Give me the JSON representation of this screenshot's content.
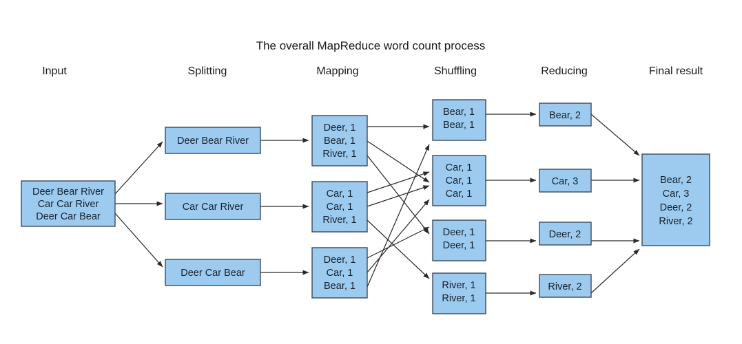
{
  "title": "The overall MapReduce word count process",
  "colors": {
    "box_fill": "#9dcbf0",
    "box_stroke": "#3a4a5a",
    "edge": "#2b2b2b",
    "text": "#16202b",
    "background": "#ffffff"
  },
  "headers": [
    {
      "label": "Input"
    },
    {
      "label": "Splitting"
    },
    {
      "label": "Mapping"
    },
    {
      "label": "Shuffling"
    },
    {
      "label": "Reducing"
    },
    {
      "label": "Final result"
    }
  ],
  "stages": {
    "input": {
      "label": "Input",
      "boxes": [
        {
          "lines": [
            "Deer Bear River",
            "Car Car River",
            "Deer Car Bear"
          ]
        }
      ]
    },
    "splitting": {
      "label": "Splitting",
      "boxes": [
        {
          "lines": [
            "Deer Bear River"
          ]
        },
        {
          "lines": [
            "Car Car River"
          ]
        },
        {
          "lines": [
            "Deer Car Bear"
          ]
        }
      ]
    },
    "mapping": {
      "label": "Mapping",
      "boxes": [
        {
          "lines": [
            "Deer, 1",
            "Bear, 1",
            "River, 1"
          ]
        },
        {
          "lines": [
            "Car, 1",
            "Car, 1",
            "River, 1"
          ]
        },
        {
          "lines": [
            "Deer, 1",
            "Car, 1",
            "Bear, 1"
          ]
        }
      ]
    },
    "shuffling": {
      "label": "Shuffling",
      "boxes": [
        {
          "lines": [
            "Bear, 1",
            "Bear, 1"
          ]
        },
        {
          "lines": [
            "Car, 1",
            "Car, 1",
            "Car, 1"
          ]
        },
        {
          "lines": [
            "Deer, 1",
            "Deer, 1"
          ]
        },
        {
          "lines": [
            "River, 1",
            "River, 1"
          ]
        }
      ]
    },
    "reducing": {
      "label": "Reducing",
      "boxes": [
        {
          "lines": [
            "Bear, 2"
          ]
        },
        {
          "lines": [
            "Car, 3"
          ]
        },
        {
          "lines": [
            "Deer, 2"
          ]
        },
        {
          "lines": [
            "River, 2"
          ]
        }
      ]
    },
    "final_result": {
      "label": "Final result",
      "boxes": [
        {
          "lines": [
            "Bear, 2",
            "Car, 3",
            "Deer, 2",
            "River, 2"
          ]
        }
      ]
    }
  }
}
